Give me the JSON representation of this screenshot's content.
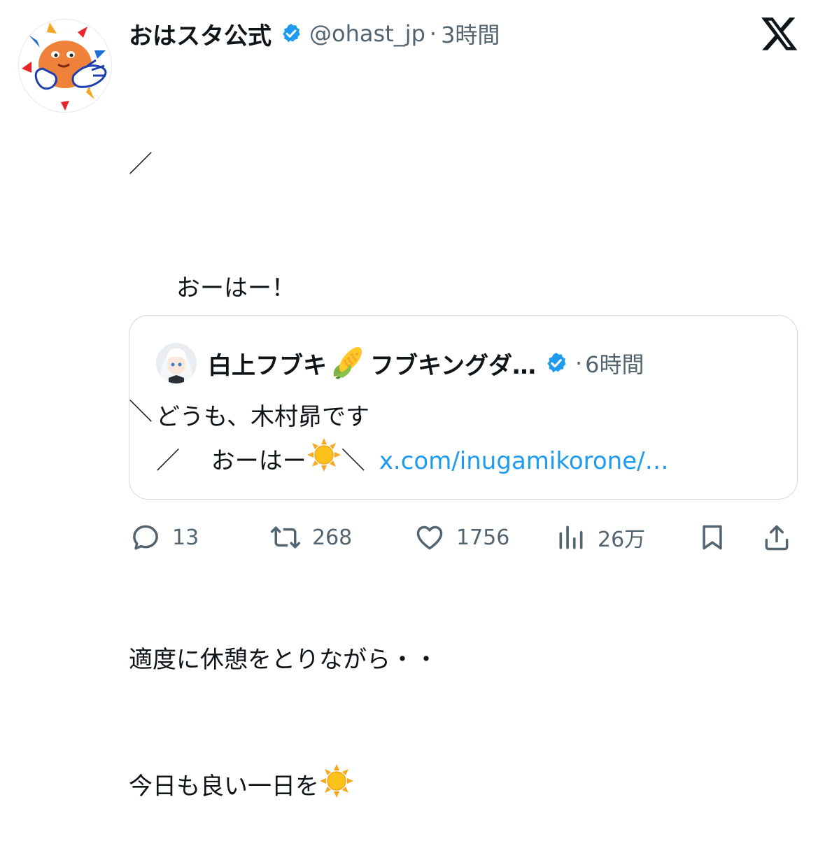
{
  "post": {
    "display_name": "おはスタ公式",
    "handle": "@ohast_jp",
    "separator": "·",
    "time": "3時間",
    "body_lines": [
      "／",
      "　　おーはー！",
      "＼",
      "",
      "適度に休憩をとりながら・・"
    ],
    "body_last": "今日も良い一日を"
  },
  "quote": {
    "display_name": "白上フブキ",
    "display_name_rest": "フブキングダ…",
    "separator": "·",
    "time": "6時間",
    "line1": "どうも、木村昴です",
    "line2_start": "／　 おーはー",
    "line2_end": "＼",
    "link": "x.com/inugamikorone/…"
  },
  "actions": {
    "replies": "13",
    "reposts": "268",
    "likes": "1756",
    "views": "26万"
  },
  "icons": {
    "verified": "verified-badge-icon",
    "logo": "x-logo-icon",
    "sun": "sun-emoji",
    "corn": "corn-emoji",
    "reply": "reply-icon",
    "repost": "repost-icon",
    "like": "heart-icon",
    "views": "views-icon",
    "bookmark": "bookmark-icon",
    "share": "share-icon"
  },
  "colors": {
    "verified_blue": "#1d9bf0",
    "secondary_text": "#536471",
    "link": "#1d9bf0"
  }
}
